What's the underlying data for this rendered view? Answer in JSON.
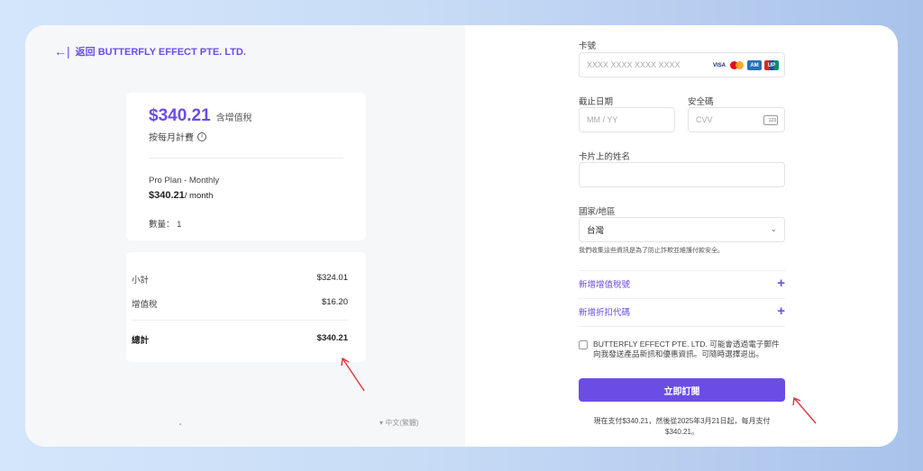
{
  "left": {
    "back_label": "返回 BUTTERFLY EFFECT PTE. LTD.",
    "summary": {
      "price": "$340.21",
      "vat_note": "含增值稅",
      "billing": "按每月計費",
      "plan_name": "Pro Plan - Monthly",
      "plan_price": "$340.21",
      "plan_period": "/ month",
      "quantity": "數量： 1"
    },
    "totals": {
      "subtotal_label": "小計",
      "subtotal_value": "$324.01",
      "vat_label": "增值稅",
      "vat_value": "$16.20",
      "total_label": "總計",
      "total_value": "$340.21"
    },
    "language": "中文(繁體)"
  },
  "form": {
    "card_number_label": "卡號",
    "card_number_placeholder": "XXXX XXXX XXXX XXXX",
    "card_brands": [
      "VISA",
      "mastercard",
      "amex",
      "unionpay"
    ],
    "expiry_label": "截止日期",
    "expiry_placeholder": "MM / YY",
    "cvc_label": "安全碼",
    "cvc_placeholder": "CVV",
    "name_label": "卡片上的姓名",
    "name_value": "",
    "country_label": "國家/地區",
    "country_value": "台灣",
    "privacy_note": "我們收集這些資訊是為了防止詐欺並維護付款安全。",
    "add_tax_id": "新增增值稅號",
    "add_promo": "新增折扣代碼",
    "consent": "BUTTERFLY EFFECT PTE. LTD. 可能會透過電子郵件向我發送產品新訊和優惠資訊。可隨時選擇退出。",
    "subscribe_button": "立即訂閱",
    "footer_note": "現在支付$340.21，然後從2025年3月21日起，每月支付 $340.21。"
  },
  "colors": {
    "accent": "#6b4de6",
    "annotation_arrow": "#d9363e"
  }
}
